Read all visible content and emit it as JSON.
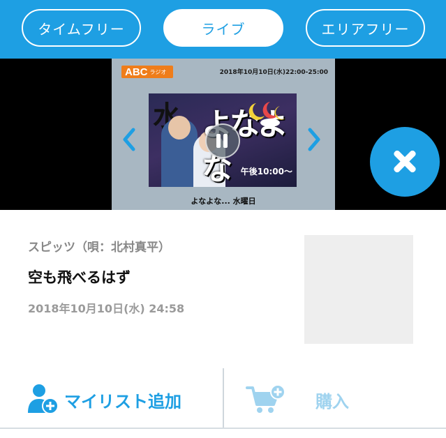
{
  "tabs": [
    {
      "label": "タイムフリー",
      "active": false
    },
    {
      "label": "ライブ",
      "active": true
    },
    {
      "label": "エリアフリー",
      "active": false
    }
  ],
  "player": {
    "station_logo_text": "ABC",
    "station_logo_sub": "ラジオ",
    "airtime": "2018年10月10日(水)22:00-25:00",
    "artwork_text": {
      "kanji": "水",
      "title": "よなよな",
      "time": "午後10:00〜"
    },
    "program_name": "よなよな... 水曜日",
    "state": "playing"
  },
  "track": {
    "artist": "スピッツ（唄：北村真平）",
    "title": "空も飛べるはず",
    "datetime": "2018年10月10日(水) 24:58"
  },
  "actions": {
    "mylist_label": "マイリスト追加",
    "buy_label": "購入"
  },
  "colors": {
    "accent": "#1e9fe3",
    "accent_light": "#9fd3ef",
    "player_bg": "#000000",
    "station_card": "#a8b7c2",
    "logo_orange": "#ef7d1a"
  },
  "icons": [
    "chevron-left-icon",
    "chevron-right-icon",
    "pause-icon",
    "close-icon",
    "add-user-icon",
    "cart-add-icon"
  ]
}
